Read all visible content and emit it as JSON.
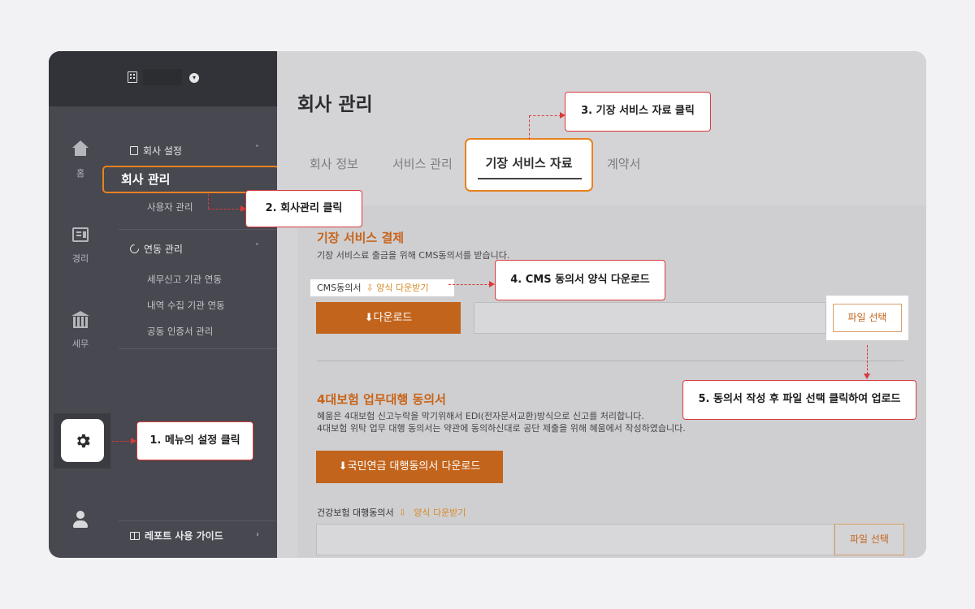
{
  "sidebar": {
    "rail": [
      {
        "label": "홈",
        "icon": "home-icon"
      },
      {
        "label": "경리",
        "icon": "ledger-icon"
      },
      {
        "label": "세무",
        "icon": "bank-icon"
      }
    ],
    "sections": {
      "company_settings": "회사 설정",
      "integration": "연동 관리"
    },
    "items": {
      "company_management": "회사 관리",
      "user_management": "사용자 관리",
      "tax_agency_link": "세무신고 기관 연동",
      "statement_link": "내역 수집 기관 연동",
      "certificate_mgmt": "공동 인증서 관리"
    },
    "guide": "레포트 사용 가이드"
  },
  "main": {
    "title": "회사 관리",
    "tabs": [
      "회사 정보",
      "서비스 관리",
      "기장 서비스 자료",
      "계약서"
    ],
    "active_tab": "기장 서비스 자료"
  },
  "section1": {
    "title": "기장 서비스 결제",
    "desc": "기장 서비스료 출금을 위해 CMS동의서를 받습니다.",
    "cms_label": "CMS동의서",
    "cms_link": "양식 다운받기",
    "download_btn": "다운로드",
    "file_btn": "파일 선택"
  },
  "section2": {
    "title": "4대보험 업무대행 동의서",
    "desc1": "혜움은 4대보험 신고누락을 막기위해서 EDI(전자문서교환)방식으로 신고를 처리합니다.",
    "desc2": "4대보험 위탁 업무 대행 동의서는 약관에 동의하신대로 공단 제출을 위해 혜움에서 작성하였습니다.",
    "pension_btn": "국민연금 대행동의서 다운로드",
    "health_label": "건강보험 대행동의서",
    "health_link": "양식 다운받기",
    "file_btn": "파일 선택"
  },
  "callouts": {
    "c1": "1. 메뉴의 설정 클릭",
    "c2": "2.  회사관리 클릭",
    "c3": "3.  기장 서비스 자료 클릭",
    "c4": "4.  CMS 동의서 양식 다운로드",
    "c5": "5.  동의서 작성 후 파일 선택 클릭하여 업로드"
  },
  "colors": {
    "accent": "#c2641c",
    "highlight": "#e8821f",
    "callout_border": "#d93a3a",
    "sidebar": "#474850"
  }
}
